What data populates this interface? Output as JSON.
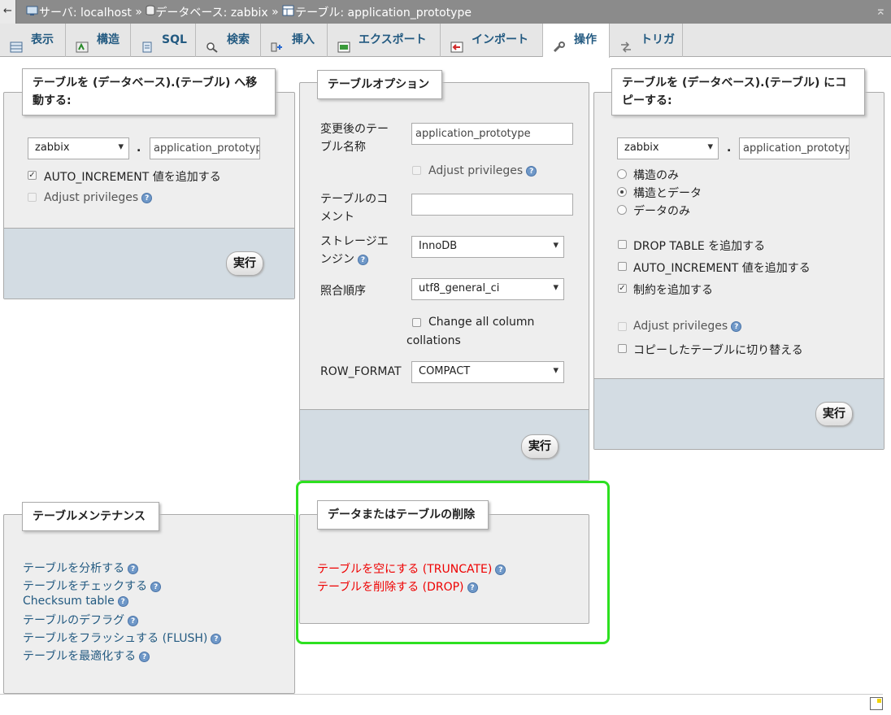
{
  "breadcrumb": {
    "server": "サーバ: localhost",
    "sep": "»",
    "database": "データベース: zabbix",
    "table": "テーブル: application_prototype"
  },
  "tabs": [
    {
      "label": "表示"
    },
    {
      "label": "構造"
    },
    {
      "label": "SQL"
    },
    {
      "label": "検索"
    },
    {
      "label": "挿入"
    },
    {
      "label": "エクスポート"
    },
    {
      "label": "インポート"
    },
    {
      "label": "操作"
    },
    {
      "label": "トリガ"
    }
  ],
  "move": {
    "title_line1": "テーブルを (データベース).(テーブル) へ移",
    "title_line2": "動する:",
    "db": "zabbix",
    "dot": ".",
    "table": "application_prototyp",
    "auto_increment": "AUTO_INCREMENT 値を追加する",
    "adjust": "Adjust privileges",
    "go": "実行"
  },
  "options": {
    "title": "テーブルオプション",
    "rename_line1": "変更後のテー",
    "rename_line2": "ブル名称",
    "rename_value": "application_prototype",
    "adjust": "Adjust privileges",
    "comment_line1": "テーブルのコ",
    "comment_line2": "メント",
    "comment_value": "",
    "engine_line1": "ストレージエ",
    "engine_line2": "ンジン",
    "engine_value": "InnoDB",
    "collation_label": "照合順序",
    "collation_value": "utf8_general_ci",
    "change_all_line1": "Change all column",
    "change_all_line2": "collations",
    "row_format_label": "ROW_FORMAT",
    "row_format_value": "COMPACT",
    "go": "実行"
  },
  "copy": {
    "title_line1": "テーブルを (データベース).(テーブル) にコ",
    "title_line2": "ピーする:",
    "db": "zabbix",
    "dot": ".",
    "table": "application_prototyp",
    "structure_only": "構造のみ",
    "structure_data": "構造とデータ",
    "data_only": "データのみ",
    "drop_table": "DROP TABLE を追加する",
    "auto_increment": "AUTO_INCREMENT 値を追加する",
    "constraints": "制約を追加する",
    "adjust": "Adjust privileges",
    "switch": "コピーしたテーブルに切り替える",
    "go": "実行"
  },
  "maintenance": {
    "title": "テーブルメンテナンス",
    "links": [
      "テーブルを分析する",
      "テーブルをチェックする",
      "Checksum table",
      "テーブルのデフラグ",
      "テーブルをフラッシュする (FLUSH)",
      "テーブルを最適化する"
    ]
  },
  "delete": {
    "title": "データまたはテーブルの削除",
    "truncate": "テーブルを空にする (TRUNCATE)",
    "drop": "テーブルを削除する (DROP)"
  },
  "colors": {
    "highlight": "#2de020",
    "link": "#235a81",
    "danger": "#e00000",
    "footer": "#d3dce3"
  }
}
